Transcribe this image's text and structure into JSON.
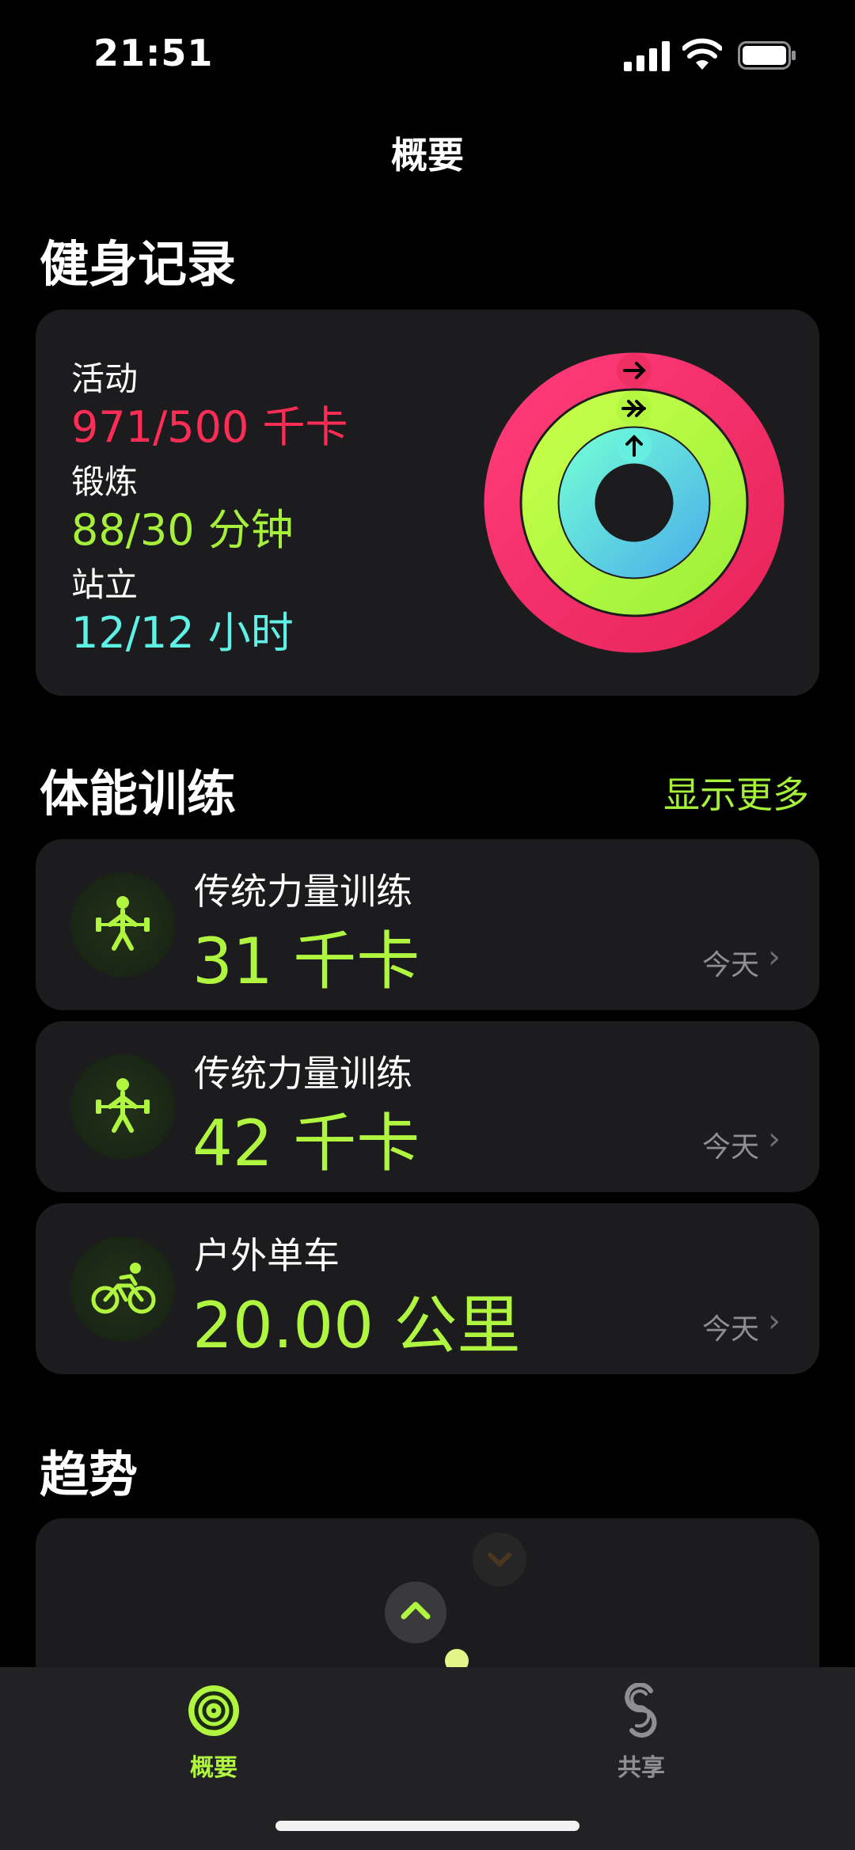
{
  "status_bar": {
    "time": "21:51"
  },
  "nav": {
    "title": "概要"
  },
  "activity": {
    "section_title": "健身记录",
    "move": {
      "label": "活动",
      "value": "971/500 千卡",
      "color": "#ff2d55",
      "progress": 1.94
    },
    "exercise": {
      "label": "锻炼",
      "value": "88/30 分钟",
      "color": "#a6f03c",
      "progress": 2.93
    },
    "stand": {
      "label": "站立",
      "value": "12/12 小时",
      "color": "#5ff0e6",
      "progress": 1.0
    }
  },
  "workouts": {
    "section_title": "体能训练",
    "show_more": "显示更多",
    "items": [
      {
        "name": "传统力量训练",
        "value": "31 千卡",
        "date": "今天",
        "icon": "weightlifting-icon"
      },
      {
        "name": "传统力量训练",
        "value": "42 千卡",
        "date": "今天",
        "icon": "weightlifting-icon"
      },
      {
        "name": "户外单车",
        "value": "20.00 公里",
        "date": "今天",
        "icon": "cycling-icon"
      }
    ]
  },
  "trends": {
    "section_title": "趋势"
  },
  "tabbar": {
    "items": [
      {
        "label": "概要",
        "active": true,
        "icon": "activity-rings-icon"
      },
      {
        "label": "共享",
        "active": false,
        "icon": "sharing-icon"
      }
    ]
  },
  "colors": {
    "accent": "#a6f03c",
    "move": "#ff2d55",
    "stand": "#5ff0e6",
    "card": "#1c1c1e"
  }
}
